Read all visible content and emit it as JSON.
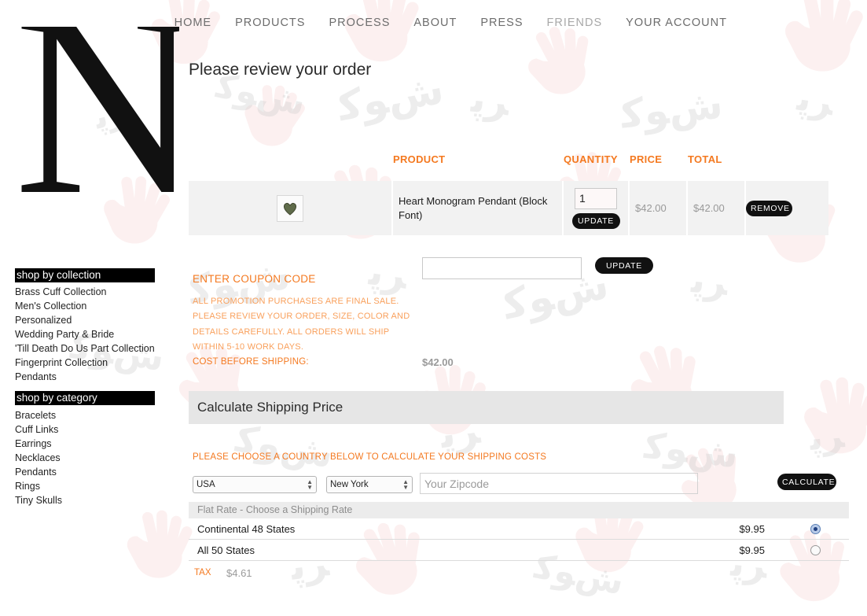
{
  "brand": {
    "logo_letter": "N"
  },
  "nav": {
    "items": [
      {
        "label": "HOME",
        "dim": false
      },
      {
        "label": "PRODUCTS",
        "dim": false
      },
      {
        "label": "PROCESS",
        "dim": false
      },
      {
        "label": "ABOUT",
        "dim": false
      },
      {
        "label": "PRESS",
        "dim": false
      },
      {
        "label": "FRIENDS",
        "dim": true
      },
      {
        "label": "YOUR ACCOUNT",
        "dim": false
      }
    ]
  },
  "page": {
    "title": "Please review your order"
  },
  "sidebar": {
    "collection_heading": "shop by collection",
    "collection_items": [
      "Brass Cuff Collection",
      "Men's Collection",
      "Personalized",
      "Wedding Party & Bride",
      "'Till Death Do Us Part Collection",
      "Fingerprint Collection",
      "Pendants"
    ],
    "category_heading": "shop by category",
    "category_items": [
      "Bracelets",
      "Cuff Links",
      "Earrings",
      "Necklaces",
      "Pendants",
      "Rings",
      "Tiny Skulls"
    ]
  },
  "cart": {
    "headers": {
      "image": "",
      "product": "PRODUCT",
      "quantity": "QUANTITY",
      "price": "PRICE",
      "total": "TOTAL",
      "remove": ""
    },
    "rows": [
      {
        "thumb_icon": "heart-pendant-thumbnail",
        "name": "Heart Monogram Pendant (Block Font)",
        "quantity": "1",
        "update_label": "UPDATE",
        "price": "$42.00",
        "total": "$42.00",
        "remove_label": "REMOVE"
      }
    ]
  },
  "coupon": {
    "value": "",
    "placeholder": "",
    "update_label": "UPDATE",
    "label": "ENTER COUPON CODE",
    "note": "ALL PROMOTION PURCHASES ARE FINAL SALE. PLEASE REVIEW YOUR ORDER, SIZE, COLOR AND DETAILS CAREFULLY. ALL ORDERS WILL SHIP WITHIN 5-10 WORK DAYS.",
    "cost_label": "COST BEFORE SHIPPING:",
    "cost_value": "$42.00"
  },
  "shipping": {
    "section_title": "Calculate Shipping Price",
    "note": "PLEASE CHOOSE A COUNTRY BELOW TO CALCULATE YOUR SHIPPING COSTS",
    "country_selected": "USA",
    "state_selected": "New York",
    "zip_value": "",
    "zip_placeholder": "Your Zipcode",
    "calculate_label": "CALCULATE",
    "rate_header": "Flat Rate - Choose a Shipping Rate",
    "rates": [
      {
        "name": "Continental 48 States",
        "price": "$9.95",
        "selected": true
      },
      {
        "name": "All 50 States",
        "price": "$9.95",
        "selected": false
      }
    ],
    "tax_label": "TAX",
    "tax_value": "$4.61"
  },
  "colors": {
    "accent_orange": "#f47920",
    "accent_orange_light": "#f9a05c",
    "row_bg": "#f2f2f2",
    "bar_bg": "#e6e6e6",
    "black": "#111111"
  }
}
